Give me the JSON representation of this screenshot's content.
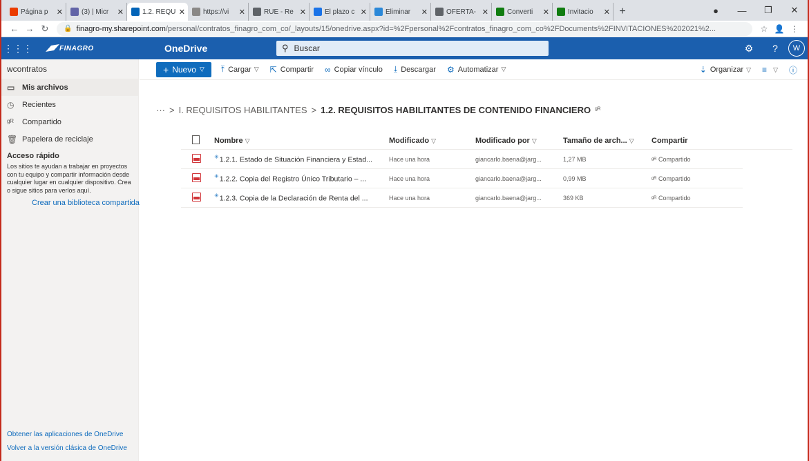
{
  "browser": {
    "tabs": [
      {
        "title": "Página p",
        "icon": "office-icon",
        "color": "#eb3c00"
      },
      {
        "title": "(3) | Micr",
        "icon": "teams-icon",
        "color": "#6264a7"
      },
      {
        "title": "1.2. REQU",
        "icon": "onedrive-icon",
        "color": "#0364b8",
        "active": true
      },
      {
        "title": "https://vi",
        "icon": "page-icon",
        "color": "#8a8886"
      },
      {
        "title": "RUE - Re",
        "icon": "globe-icon",
        "color": "#5f6368"
      },
      {
        "title": "El plazo c",
        "icon": "at-icon",
        "color": "#1a73e8"
      },
      {
        "title": "Eliminar",
        "icon": "tile-icon",
        "color": "#2b88d8"
      },
      {
        "title": "OFERTA-",
        "icon": "globe-icon",
        "color": "#5f6368"
      },
      {
        "title": "Converti",
        "icon": "convert-icon",
        "color": "#107c10"
      },
      {
        "title": "Invitacio",
        "icon": "arrow-icon",
        "color": "#107c10"
      }
    ],
    "new_tab": "+",
    "url_host": "finagro-my.sharepoint.com",
    "url_path": "/personal/contratos_finagro_com_co/_layouts/15/onedrive.aspx?id=%2Fpersonal%2Fcontratos_finagro_com_co%2FDocuments%2FINVITACIONES%202021%2..."
  },
  "suite": {
    "logo_text": "FINAGRO",
    "app_name": "OneDrive",
    "search_placeholder": "Buscar",
    "avatar_initial": "W"
  },
  "sidebar": {
    "user": "wcontratos",
    "items": [
      {
        "label": "Mis archivos",
        "icon": "folder-icon"
      },
      {
        "label": "Recientes",
        "icon": "clock-icon"
      },
      {
        "label": "Compartido",
        "icon": "people-icon"
      },
      {
        "label": "Papelera de reciclaje",
        "icon": "recycle-bin-icon"
      }
    ],
    "quick_access_title": "Acceso rápido",
    "quick_access_desc": "Los sitios te ayudan a trabajar en proyectos con tu equipo y compartir información desde cualquier lugar en cualquier dispositivo. Crea o sigue sitios para verlos aquí.",
    "create_library": "Crear una biblioteca compartida",
    "get_apps": "Obtener las aplicaciones de OneDrive",
    "classic": "Volver a la versión clásica de OneDrive"
  },
  "commands": {
    "new": "Nuevo",
    "upload": "Cargar",
    "share": "Compartir",
    "copy_link": "Copiar vínculo",
    "download": "Descargar",
    "automate": "Automatizar",
    "sort": "Organizar"
  },
  "breadcrumb": {
    "parent": "I. REQUISITOS HABILITANTES",
    "current": "1.2. REQUISITOS HABILITANTES DE CONTENIDO FINANCIERO"
  },
  "table": {
    "headers": {
      "name": "Nombre",
      "modified": "Modificado",
      "modified_by": "Modificado por",
      "size": "Tamaño de arch...",
      "sharing": "Compartir"
    },
    "rows": [
      {
        "name": "1.2.1. Estado de Situación Financiera y Estad...",
        "modified": "Hace una hora",
        "modified_by": "giancarlo.baena@jarg...",
        "size": "1,27 MB",
        "sharing": "Compartido"
      },
      {
        "name": "1.2.2. Copia del Registro Único Tributario – ...",
        "modified": "Hace una hora",
        "modified_by": "giancarlo.baena@jarg...",
        "size": "0,99 MB",
        "sharing": "Compartido"
      },
      {
        "name": "1.2.3. Copia de la Declaración de Renta del ...",
        "modified": "Hace una hora",
        "modified_by": "giancarlo.baena@jarg...",
        "size": "369 KB",
        "sharing": "Compartido"
      }
    ]
  }
}
